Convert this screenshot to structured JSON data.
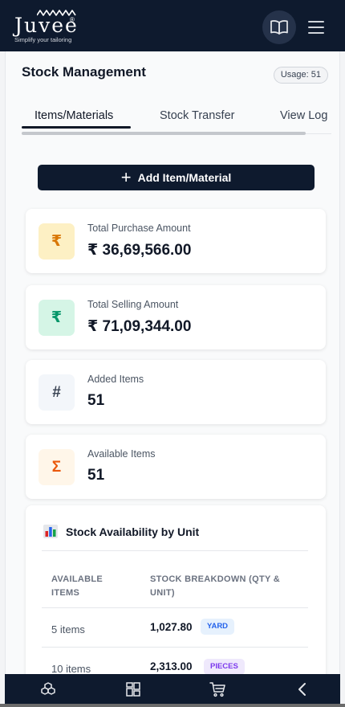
{
  "brand": {
    "name": "Juvee",
    "registered": "®",
    "tagline": "Simplify your tailoring"
  },
  "header": {
    "book_icon": "book-open-icon",
    "menu_icon": "hamburger-menu-icon"
  },
  "page": {
    "title": "Stock Management",
    "usage": "Usage: 51"
  },
  "tabs": [
    {
      "label": "Items/Materials",
      "active": true
    },
    {
      "label": "Stock Transfer",
      "active": false
    },
    {
      "label": "View Log",
      "active": false
    }
  ],
  "add_button": {
    "icon": "+",
    "label": "Add Item/Material"
  },
  "stats": [
    {
      "label": "Total Purchase Amount",
      "value": "₹ 36,69,566.00",
      "icon": "₹",
      "icon_color": "#d97706",
      "icon_bg": "#fdf0c4"
    },
    {
      "label": "Total Selling Amount",
      "value": "₹ 71,09,344.00",
      "icon": "₹",
      "icon_color": "#059669",
      "icon_bg": "#d5f5e6"
    },
    {
      "label": "Added Items",
      "value": "51",
      "icon": "#",
      "icon_color": "#374151",
      "icon_bg": "#f3f6fa"
    },
    {
      "label": "Available Items",
      "value": "51",
      "icon": "Σ",
      "icon_color": "#ea580c",
      "icon_bg": "#fff6e9"
    }
  ],
  "availability": {
    "title": "Stock Availability by Unit",
    "icon": "bar-chart-icon",
    "col_items": "AVAILABLE ITEMS",
    "col_breakdown": "STOCK BREAKDOWN (QTY & UNIT)",
    "rows": [
      {
        "items": "5 items",
        "qty": "1,027.80",
        "unit": "YARD",
        "unit_color": "#2563eb",
        "unit_bg": "#e6f1fd"
      },
      {
        "items": "10 items",
        "qty": "2,313.00",
        "unit": "PIECES",
        "unit_color": "#7c3aed",
        "unit_bg": "#efe9fc"
      }
    ]
  },
  "bottom_nav": [
    "cubes-icon",
    "dashboard-grid-icon",
    "cart-icon",
    "back-chevron-icon"
  ],
  "colors": {
    "navy": "#0e1a2e",
    "text": "#111827",
    "muted": "#6b7280"
  }
}
